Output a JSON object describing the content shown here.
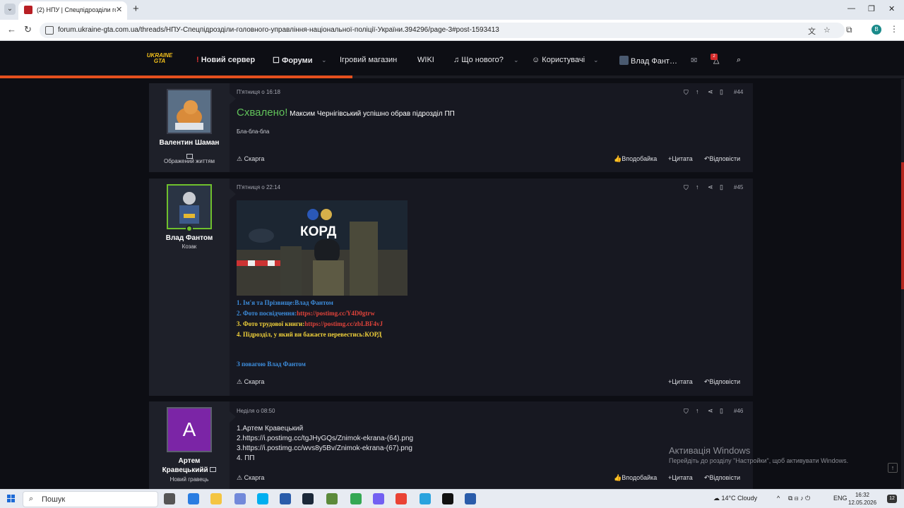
{
  "browser": {
    "tab_title": "(2) НПУ | Спецпідрозділи голо…",
    "url": "forum.ukraine-gta.com.ua/threads/НПУ-Спецпідрозділи-головного-управління-національної-поліції-України.394296/page-3#post-1593413",
    "profile_letter": "B"
  },
  "site": {
    "logo_top": "UKRAINE",
    "logo_bottom": "GTA",
    "nav": {
      "new_server": "Новий сервер",
      "forums": "Форуми",
      "shop": "Ігровий магазин",
      "wiki": "WIKI",
      "whats_new": "Що нового?",
      "users": "Користувачі",
      "account": "Влад Фант…",
      "alerts_count": "2"
    },
    "progress_percent": 39
  },
  "posts": [
    {
      "author": "Валентин Шаман",
      "user_title": "Ображений життям",
      "date": "П'ятниця о 16:18",
      "number": "#44",
      "approved_word": "Схвалено!",
      "approved_rest": " Максим Чернігівський успішно обрав підрозділ ПП",
      "body": "Бла-бла-бла",
      "report": "Скарга",
      "like": "Вподобайка",
      "quote": "+Цитата",
      "reply": "Відповісти"
    },
    {
      "author": "Влад Фантом",
      "user_title": "Козак",
      "date": "П'ятниця о 22:14",
      "number": "#45",
      "banner_text": "КОРД",
      "lines": [
        {
          "label": "1. Ім'я та Прізвище:",
          "value": "Влад Фантом",
          "color": "#3d8ede",
          "value_color": "#3d8ede"
        },
        {
          "label": "2. Фото посвідчення:",
          "value": "https://postimg.cc/Y4D0gtrw",
          "color": "#3d8ede",
          "value_color": "#e0433a"
        },
        {
          "label": "3. Фото трудової книги:",
          "value": "https://postimg.cc/zbLBF4vJ",
          "color": "#f2d23a",
          "value_color": "#e0433a"
        },
        {
          "label": "4. Підрозділ, у який ви бажаєте перевестись:",
          "value": "КОРД",
          "color": "#f2d23a",
          "value_color": "#f2d23a"
        }
      ],
      "signoff": "З повагою Влад Фантом",
      "report": "Скарга",
      "quote": "+Цитата",
      "reply": "Відповісти"
    },
    {
      "author_line1": "Артем",
      "author_line2": "Кравецькийй",
      "avatar_letter": "А",
      "user_title": "Новий гравець",
      "date": "Неділя о 08:50",
      "number": "#46",
      "lines": [
        "1.Артем Кравецький",
        "2.https://i.postimg.cc/tgJHyGQs/Znimok-ekrana-(64).png",
        "3.https://i.postimg.cc/wvs8y5Bv/Znimok-ekrana-(67).png",
        "4. ПП"
      ],
      "report": "Скарга",
      "like": "Вподобайка",
      "quote": "+Цитата",
      "reply": "Відповісти"
    }
  ],
  "watermark": {
    "title": "Активація Windows",
    "subtitle": "Перейдіть до розділу \"Настройки\", щоб активувати Windows."
  },
  "taskbar": {
    "search": "Пошук",
    "weather": "14°C  Cloudy",
    "lang": "ENG",
    "time": "16:32",
    "date": "12.05.2026",
    "notifications": "12"
  }
}
